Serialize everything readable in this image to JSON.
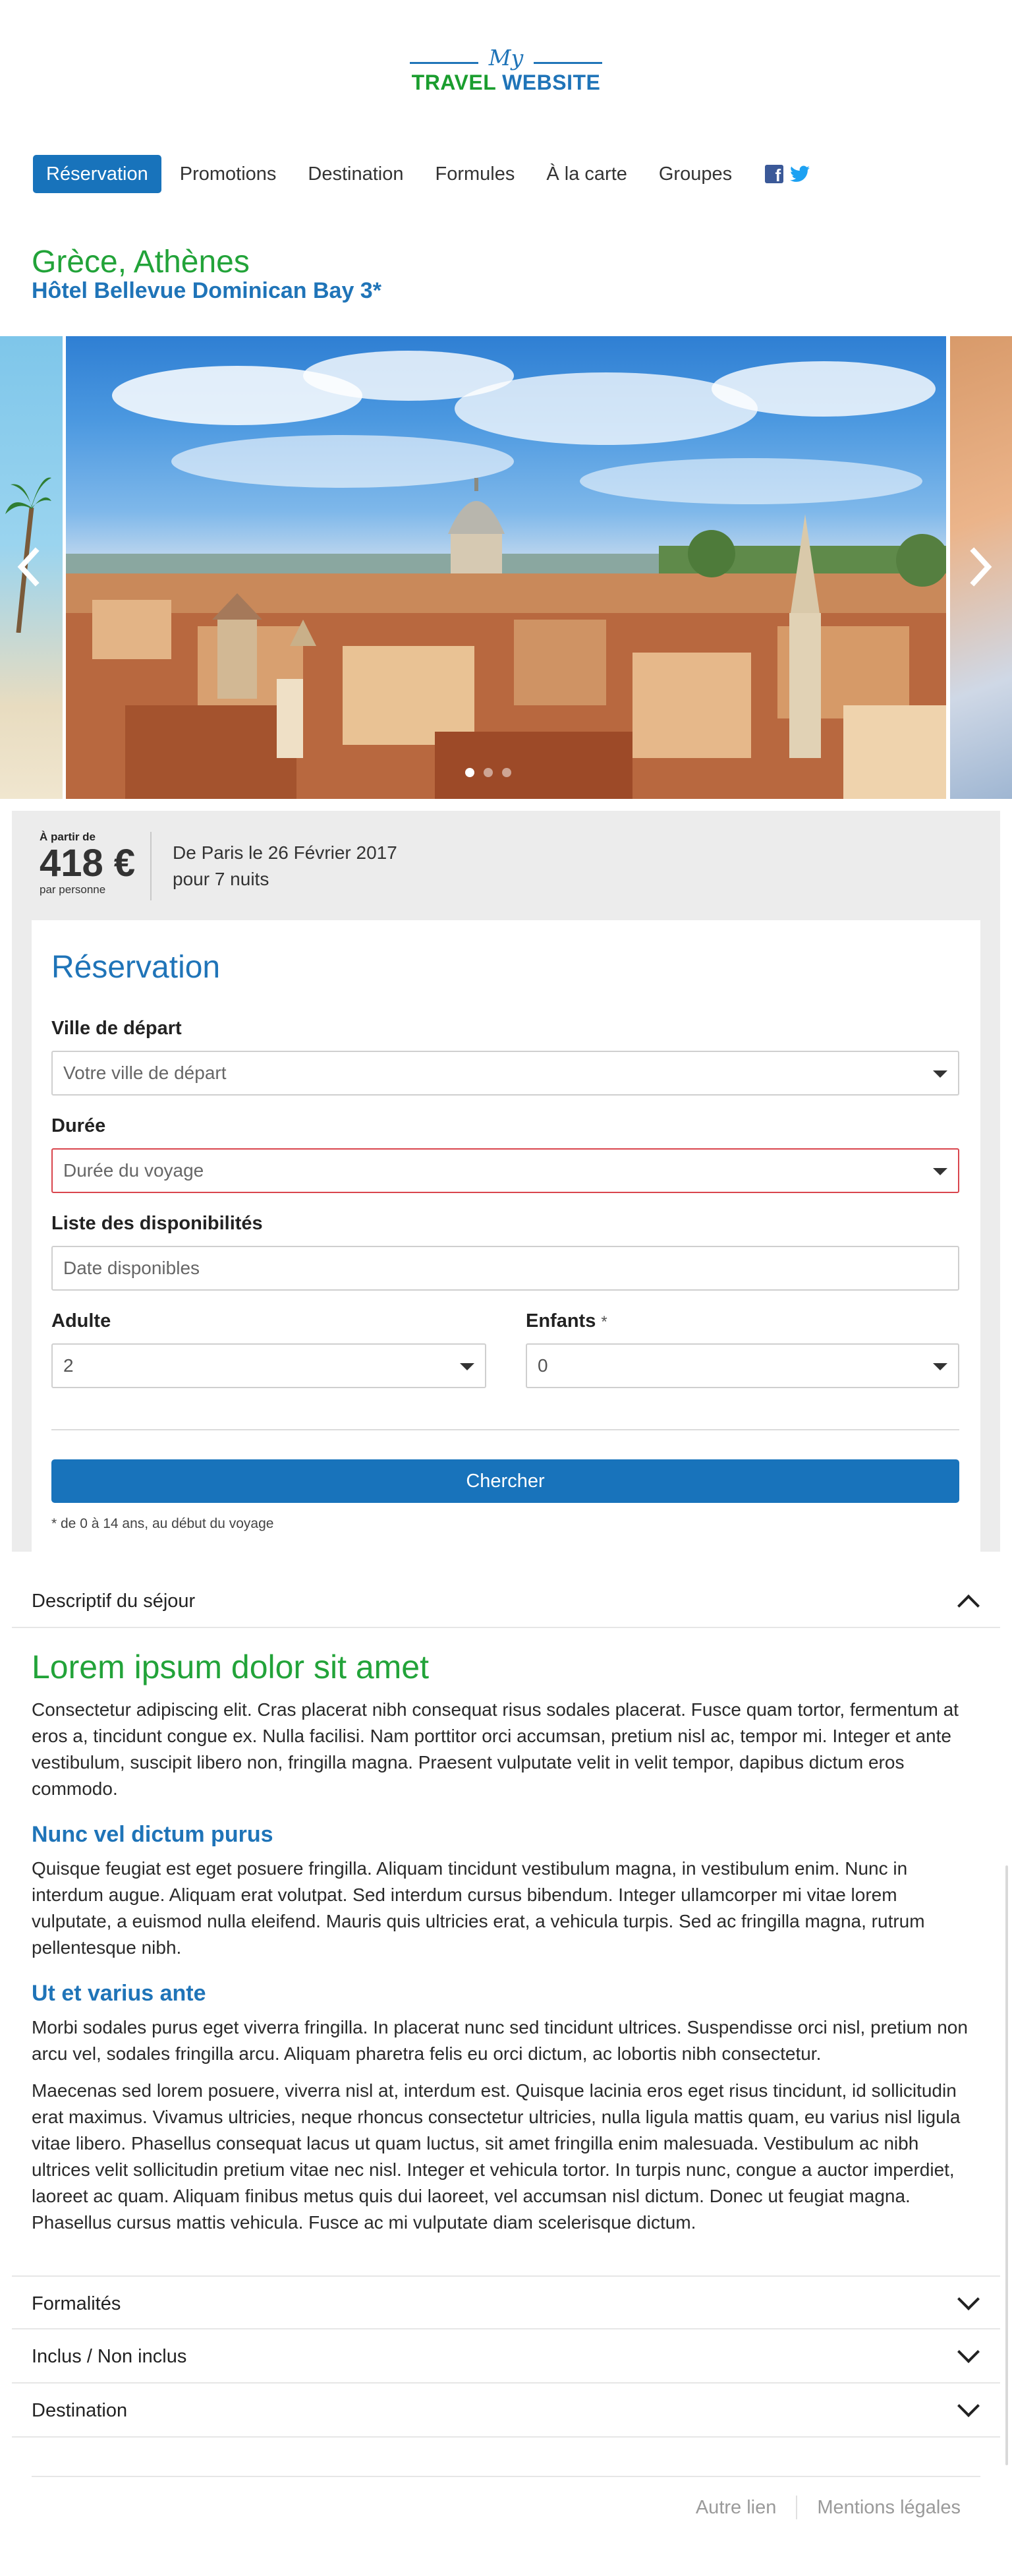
{
  "logo": {
    "line1": "My",
    "line2a": "TRAVEL",
    "line2b": "WEBSITE"
  },
  "nav": {
    "items": [
      "Réservation",
      "Promotions",
      "Destination",
      "Formules",
      "À la carte",
      "Groupes"
    ],
    "active_index": 0,
    "social": [
      "facebook-icon",
      "twitter-icon"
    ]
  },
  "hero": {
    "destination": "Grèce, Athènes",
    "hotel": "Hôtel Bellevue Dominican Bay 3*",
    "carousel_dots": 3,
    "active_dot": 0
  },
  "price": {
    "from_label": "À partir de",
    "value": "418 €",
    "per_label": "par personne",
    "departure_line": "De Paris le 26 Février 2017",
    "duration_line": "pour 7 nuits"
  },
  "reservation": {
    "title": "Réservation",
    "departure_label": "Ville de départ",
    "departure_placeholder": "Votre ville de départ",
    "duration_label": "Durée",
    "duration_placeholder": "Durée du voyage",
    "availability_label": "Liste des disponibilités",
    "availability_placeholder": "Date disponibles",
    "adult_label": "Adulte",
    "adult_value": "2",
    "children_label": "Enfants",
    "children_star": "*",
    "children_value": "0",
    "search_button": "Chercher",
    "note": "* de 0 à 14 ans, au début du voyage",
    "accent_color": "#1873bb",
    "error_color": "#d9454d"
  },
  "accordion": {
    "description": "Descriptif du séjour",
    "formalities": "Formalités",
    "included": "Inclus / Non inclus",
    "destination": "Destination"
  },
  "content": {
    "h1": "Lorem ipsum dolor sit amet",
    "p1": "Consectetur adipiscing elit. Cras placerat nibh consequat risus sodales placerat. Fusce quam tortor, fermentum at eros a, tincidunt congue ex. Nulla facilisi. Nam porttitor orci accumsan, pretium nisl ac, tempor mi. Integer et ante vestibulum, suscipit libero non, fringilla magna. Praesent vulputate velit in velit tempor, dapibus dictum eros commodo.",
    "h2a": "Nunc vel dictum purus",
    "p2": "Quisque feugiat est eget posuere fringilla. Aliquam tincidunt vestibulum magna, in vestibulum enim. Nunc in interdum augue. Aliquam erat volutpat. Sed interdum cursus bibendum. Integer ullamcorper mi vitae lorem vulputate, a euismod nulla eleifend. Mauris quis ultricies erat, a vehicula turpis. Sed ac fringilla magna, rutrum pellentesque nibh.",
    "h2b": "Ut et varius ante",
    "p3": "Morbi sodales purus eget viverra fringilla. In placerat nunc sed tincidunt ultrices. Suspendisse orci nisl, pretium non arcu vel, sodales fringilla arcu. Aliquam pharetra felis eu orci dictum, ac lobortis nibh consectetur.",
    "p4": "Maecenas sed lorem posuere, viverra nisl at, interdum est. Quisque lacinia eros eget risus tincidunt, id sollicitudin erat maximus. Vivamus ultricies, neque rhoncus consectetur ultricies, nulla ligula mattis quam, eu varius nisl ligula vitae libero. Phasellus consequat lacus ut quam luctus, sit amet fringilla enim malesuada. Vestibulum ac nibh ultrices velit sollicitudin pretium vitae nec nisl. Integer et vehicula tortor. In turpis nunc, congue a auctor imperdiet, laoreet ac quam. Aliquam finibus metus quis dui laoreet, vel accumsan nisl dictum. Donec ut feugiat magna. Phasellus cursus mattis vehicula. Fusce ac mi vulputate diam scelerisque dictum."
  },
  "footer": {
    "link1": "Autre lien",
    "link2": "Mentions légales"
  }
}
